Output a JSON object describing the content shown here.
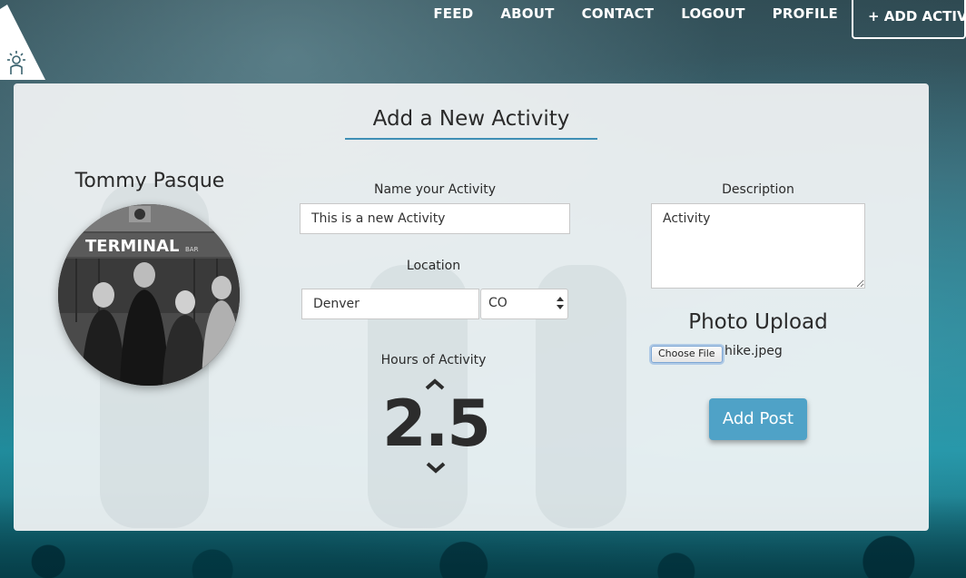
{
  "nav": {
    "items": [
      {
        "key": "feed",
        "label": "FEED"
      },
      {
        "key": "about",
        "label": "ABOUT"
      },
      {
        "key": "contact",
        "label": "CONTACT"
      },
      {
        "key": "logout",
        "label": "LOGOUT"
      },
      {
        "key": "profile",
        "label": "PROFILE"
      }
    ],
    "add_label": "+ ADD ACTIVITY"
  },
  "logo_icon": "mountain-hiker-logo-icon",
  "form": {
    "title": "Add a New Activity",
    "user_name": "Tommy Pasque",
    "avatar_sign": "TERMINAL",
    "avatar_sign_small": "BAR",
    "name_label": "Name your Activity",
    "name_value": "This is a new Activity",
    "location_label": "Location",
    "city_value": "Denver",
    "state_value": "CO",
    "hours_label": "Hours of Activity",
    "hours_value": "2.5",
    "description_label": "Description",
    "description_value": "Activity",
    "photo_title": "Photo Upload",
    "choose_file_label": "Choose File",
    "file_name": "hike.jpeg",
    "submit_label": "Add Post"
  },
  "colors": {
    "accent": "#4fa2c7",
    "title_underline": "#3f8fb5",
    "nav_text": "#ffffff"
  }
}
